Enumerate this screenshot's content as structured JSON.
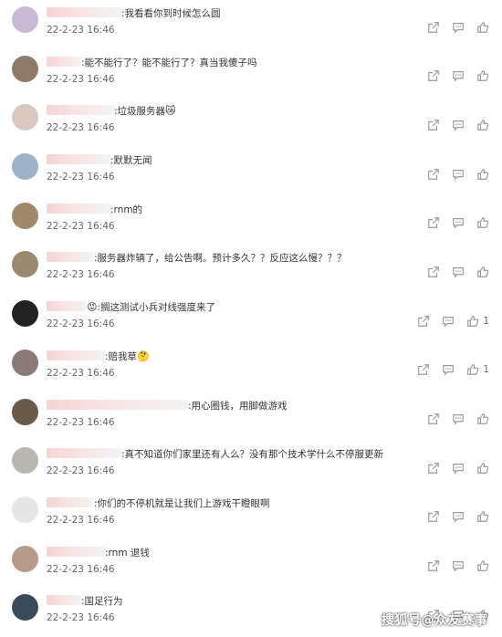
{
  "comments": [
    {
      "name_width": 82,
      "text": ":我看看你到时候怎么圆",
      "date": "22-2-23 16:46",
      "likes": "",
      "avatar_color": "#c9b8d6"
    },
    {
      "name_width": 38,
      "text": ":能不能行了？能不能行了？真当我傻子吗",
      "date": "22-2-23 16:46",
      "likes": "",
      "avatar_color": "#8f7a6a"
    },
    {
      "name_width": 74,
      "text": ":垃圾服务器",
      "emoji": "😿",
      "date": "22-2-23 16:46",
      "likes": "",
      "avatar_color": "#d8c8c0"
    },
    {
      "name_width": 70,
      "text": ":默默无闻",
      "date": "22-2-23 16:46",
      "likes": "",
      "avatar_color": "#9fb3c8"
    },
    {
      "name_width": 70,
      "text": ":rnm的",
      "date": "22-2-23 16:46",
      "likes": "",
      "avatar_color": "#a0896a"
    },
    {
      "name_width": 52,
      "text": ":服务器炸辆了，给公告啊。预计多久？？反应这么慢？？？",
      "date": "22-2-23 16:46",
      "likes": "",
      "avatar_color": "#9a8a70"
    },
    {
      "name_width": 44,
      "text": ":搁这测试小兵对线强度来了",
      "emoji_before": "😡",
      "date": "22-2-23 16:46",
      "likes": "1",
      "avatar_color": "#222222"
    },
    {
      "name_width": 64,
      "text": ":赔我草",
      "emoji": "🤔",
      "date": "22-2-23 16:46",
      "likes": "1",
      "avatar_color": "#8a7a78"
    },
    {
      "name_width": 155,
      "text": ":用心圈钱，用脚做游戏",
      "date": "22-2-23 16:46",
      "likes": "",
      "avatar_color": "#6a5a4a"
    },
    {
      "name_width": 82,
      "text": ":真不知道你们家里还有人么？没有那个技术学什么不停服更新",
      "date": "22-2-23 16:46",
      "likes": "",
      "avatar_color": "#b8b8b0"
    },
    {
      "name_width": 52,
      "text": ":你们的不停机就是让我们上游戏干瞪眼啊",
      "date": "22-2-23 16:46",
      "likes": "",
      "avatar_color": "#e6e6e6"
    },
    {
      "name_width": 64,
      "text": ":rnm 退钱",
      "date": "22-2-23 16:46",
      "likes": "",
      "avatar_color": "#b89a8a"
    },
    {
      "name_width": 38,
      "text": ":国足行为",
      "date": "22-2-23 16:46",
      "likes": "",
      "avatar_color": "#3a4a5a"
    }
  ],
  "watermark": "搜狐号@众友赛事"
}
